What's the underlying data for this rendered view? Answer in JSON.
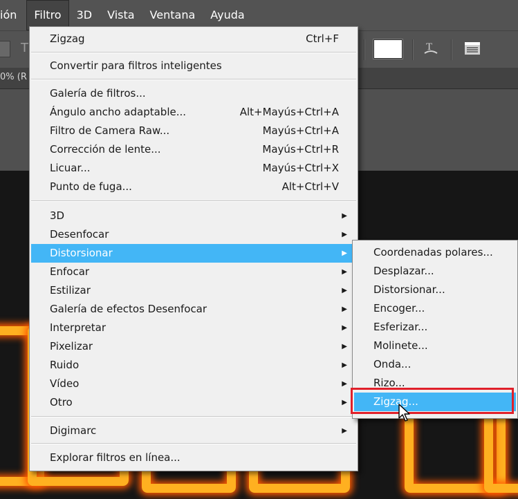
{
  "menubar": {
    "partial_item": "ión",
    "items": [
      "Filtro",
      "3D",
      "Vista",
      "Ventana",
      "Ayuda"
    ]
  },
  "doc_tab": {
    "label": "0% (R"
  },
  "options_bar": {
    "type_glyph": "T"
  },
  "filter_menu": {
    "last_filter": {
      "label": "Zigzag",
      "shortcut": "Ctrl+F"
    },
    "convert_smart": {
      "label": "Convertir para filtros inteligentes"
    },
    "gallery_group": [
      {
        "label": "Galería de filtros...",
        "shortcut": ""
      },
      {
        "label": "Ángulo ancho adaptable...",
        "shortcut": "Alt+Mayús+Ctrl+A"
      },
      {
        "label": "Filtro de Camera Raw...",
        "shortcut": "Mayús+Ctrl+A"
      },
      {
        "label": "Corrección de lente...",
        "shortcut": "Mayús+Ctrl+R"
      },
      {
        "label": "Licuar...",
        "shortcut": "Mayús+Ctrl+X"
      },
      {
        "label": "Punto de fuga...",
        "shortcut": "Alt+Ctrl+V"
      }
    ],
    "submenus": [
      {
        "label": "3D"
      },
      {
        "label": "Desenfocar"
      },
      {
        "label": "Distorsionar"
      },
      {
        "label": "Enfocar"
      },
      {
        "label": "Estilizar"
      },
      {
        "label": "Galería de efectos Desenfocar"
      },
      {
        "label": "Interpretar"
      },
      {
        "label": "Pixelizar"
      },
      {
        "label": "Ruido"
      },
      {
        "label": "Vídeo"
      },
      {
        "label": "Otro"
      }
    ],
    "digimarc": {
      "label": "Digimarc"
    },
    "browse_online": {
      "label": "Explorar filtros en línea..."
    }
  },
  "distorsionar_submenu": {
    "items": [
      "Coordenadas polares...",
      "Desplazar...",
      "Distorsionar...",
      "Encoger...",
      "Esferizar...",
      "Molinete...",
      "Onda...",
      "Rizo...",
      "Zigzag..."
    ]
  },
  "colors": {
    "menu_highlight": "#43b6f6",
    "annotation_red": "#e0202a",
    "ui_gray": "#535353",
    "glow_orange": "#ffb020"
  },
  "icons": {
    "submenu_arrow": "arrow-right-icon",
    "cursor": "mouse-cursor-icon",
    "opt_icon_1": "warp-text-icon",
    "opt_icon_2": "panels-icon"
  }
}
